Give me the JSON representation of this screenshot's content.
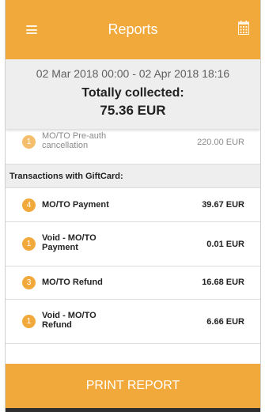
{
  "appbar": {
    "title": "Reports",
    "menu_icon": "hamburger-menu-icon",
    "calendar_icon": "calendar-icon"
  },
  "summary": {
    "date_range": "02 Mar 2018 00:00 - 02 Apr 2018 18:16",
    "label": "Totally collected:",
    "amount": "75.36 EUR"
  },
  "top_row": {
    "badge": "1",
    "name": "MO/TO Pre-auth cancellation",
    "amount": "220.00 EUR"
  },
  "section": {
    "title": "Transactions with GiftCard:"
  },
  "rows": [
    {
      "badge": "4",
      "name": "MO/TO Payment",
      "amount": "39.67 EUR"
    },
    {
      "badge": "1",
      "name": "Void - MO/TO Payment",
      "amount": "0.01 EUR"
    },
    {
      "badge": "3",
      "name": "MO/TO Refund",
      "amount": "16.68 EUR"
    },
    {
      "badge": "1",
      "name": "Void - MO/TO Refund",
      "amount": "6.66 EUR"
    }
  ],
  "footer": {
    "print_label": "PRINT REPORT"
  },
  "colors": {
    "accent": "#f2a93b",
    "summary_bg": "#eeeeee",
    "text": "#222222"
  }
}
